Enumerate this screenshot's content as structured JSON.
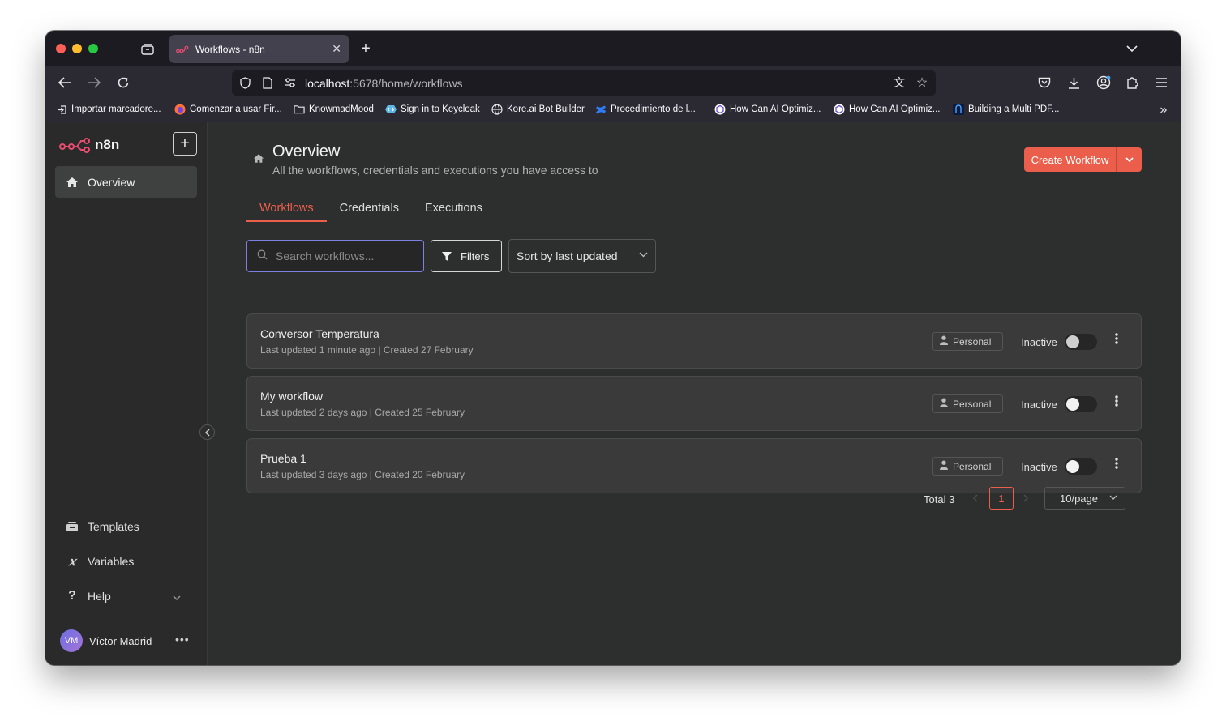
{
  "browser": {
    "tab_title": "Workflows - n8n",
    "url_host": "localhost",
    "url_rest": ":5678/home/workflows",
    "bookmarks": [
      "Importar marcadore...",
      "Comenzar a usar Fir...",
      "KnowmadMood",
      "Sign in to Keycloak",
      "Kore.ai Bot Builder",
      "Procedimiento de l...",
      "How Can AI Optimiz...",
      "How Can AI Optimiz...",
      "Building a Multi PDF..."
    ]
  },
  "sidebar": {
    "logo_text": "n8n",
    "add_label": "+",
    "items": {
      "overview": "Overview",
      "templates": "Templates",
      "variables": "Variables",
      "help": "Help"
    },
    "user": {
      "initials": "VM",
      "name": "Víctor Madrid"
    }
  },
  "header": {
    "title": "Overview",
    "subtitle": "All the workflows, credentials and executions you have access to",
    "create_button": "Create Workflow"
  },
  "tabs": [
    "Workflows",
    "Credentials",
    "Executions"
  ],
  "toolbar": {
    "search_placeholder": "Search workflows...",
    "filters_label": "Filters",
    "sort_value": "Sort by last updated"
  },
  "workflows": [
    {
      "name": "Conversor Temperatura",
      "meta": "Last updated 1 minute ago | Created 27 February",
      "owner": "Personal",
      "status": "Inactive",
      "active": false
    },
    {
      "name": "My workflow",
      "meta": "Last updated 2 days ago | Created 25 February",
      "owner": "Personal",
      "status": "Inactive",
      "active": false
    },
    {
      "name": "Prueba 1",
      "meta": "Last updated 3 days ago | Created 20 February",
      "owner": "Personal",
      "status": "Inactive",
      "active": false
    }
  ],
  "pagination": {
    "total": "Total 3",
    "current_page": "1",
    "per_page": "10/page"
  },
  "colors": {
    "accent": "#ea5e4b",
    "background": "#2d2e2e",
    "card": "#3a3a3b"
  }
}
